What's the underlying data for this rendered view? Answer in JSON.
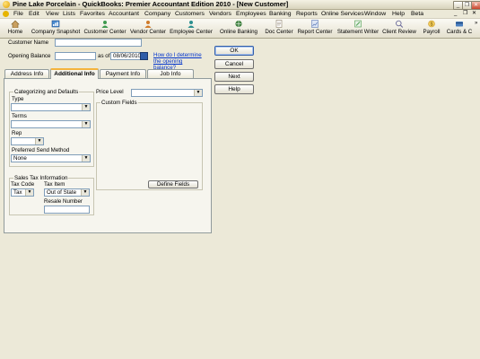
{
  "window": {
    "title": "Pine Lake Porcelain  - QuickBooks: Premier Accountant Edition 2010 - [New Customer]",
    "controls": [
      "_",
      "❐",
      "✕"
    ]
  },
  "menubar": {
    "items": [
      "File",
      "Edit",
      "View",
      "Lists",
      "Favorites",
      "Accountant",
      "Company",
      "Customers",
      "Vendors",
      "Employees",
      "Banking",
      "Reports",
      "Online Services",
      "Window",
      "Help",
      "Beta"
    ],
    "doc_controls": [
      "_",
      "❐",
      "✕"
    ]
  },
  "toolbar": {
    "buttons": [
      {
        "label": "Home",
        "icon": "home-icon",
        "color": "#C9A060"
      },
      {
        "label": "Company Snapshot",
        "icon": "snapshot-icon",
        "color": "#4A8BD0"
      },
      {
        "label": "Customer Center",
        "icon": "customer-center-icon",
        "color": "#3F9A4E"
      },
      {
        "label": "Vendor Center",
        "icon": "vendor-center-icon",
        "color": "#D07B2A"
      },
      {
        "label": "Employee Center",
        "icon": "employee-center-icon",
        "color": "#2C8F8F"
      },
      {
        "label": "Online Banking",
        "icon": "online-banking-icon",
        "color": "#3C7F3C"
      },
      {
        "label": "Doc Center",
        "icon": "doc-center-icon",
        "color": "#8A7F6A"
      },
      {
        "label": "Report Center",
        "icon": "report-center-icon",
        "color": "#5B78B8"
      },
      {
        "label": "Statement Writer",
        "icon": "statement-writer-icon",
        "color": "#4B9B4B"
      },
      {
        "label": "Client Review",
        "icon": "client-review-icon",
        "color": "#6A6A9A"
      },
      {
        "label": "Payroll",
        "icon": "payroll-icon",
        "color": "#C99A2E"
      },
      {
        "label": "Cards & C",
        "icon": "cards-icon",
        "color": "#4A7FC0"
      }
    ],
    "overflow": "»"
  },
  "form": {
    "customer_name_label": "Customer Name",
    "customer_name_value": "",
    "opening_balance_label": "Opening Balance",
    "opening_balance_value": "",
    "as_of_label": "as of",
    "as_of_date": "08/06/2010",
    "opening_balance_help_link": "How do I determine the opening balance?"
  },
  "buttons": {
    "ok": "OK",
    "cancel": "Cancel",
    "next": "Next",
    "help": "Help"
  },
  "tabs": [
    "Address Info",
    "Additional Info",
    "Payment Info",
    "Job Info"
  ],
  "active_tab": "Additional Info",
  "additional_info": {
    "categorizing_title": "Categorizing and Defaults",
    "type_label": "Type",
    "type_value": "",
    "terms_label": "Terms",
    "terms_value": "",
    "rep_label": "Rep",
    "rep_value": "",
    "preferred_send_label": "Preferred Send Method",
    "preferred_send_value": "None",
    "sales_tax_title": "Sales Tax Information",
    "tax_code_label": "Tax Code",
    "tax_code_value": "Tax",
    "tax_item_label": "Tax Item",
    "tax_item_value": "Out of State",
    "resale_number_label": "Resale Number",
    "resale_number_value": "",
    "price_level_label": "Price Level",
    "price_level_value": "",
    "custom_fields_title": "Custom Fields",
    "define_fields_button": "Define Fields"
  }
}
